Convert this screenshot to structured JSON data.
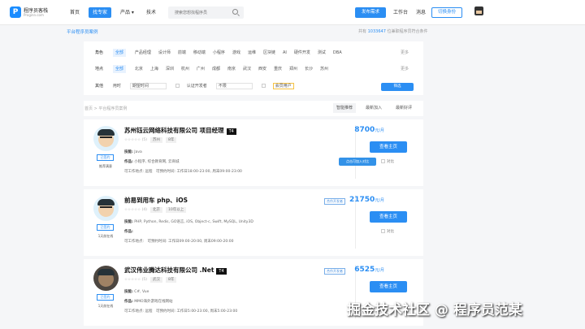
{
  "brand": {
    "title": "程序员客栈",
    "subtitle": "Proginn.com",
    "accent": "#2b8ef3"
  },
  "nav": [
    "首页",
    "找专家",
    "产品",
    "技术"
  ],
  "nav_active": 1,
  "search": {
    "placeholder": "搜索您想找程序员"
  },
  "header": {
    "post_label": "发布需求",
    "workbench": "工作台",
    "messages": "消息",
    "switch_label": "切换身份"
  },
  "subheader": {
    "link": "平台程序员案例",
    "stat_prefix": "共有",
    "stat_count": "1033647",
    "stat_suffix": "位兼职程序员符合条件"
  },
  "filters": {
    "role_label": "角色",
    "roles": [
      "全部",
      "产品经理",
      "设计师",
      "前端",
      "移动端",
      "小程序",
      "游戏",
      "运维",
      "区块链",
      "AI",
      "硬件开发",
      "测试",
      "DBA"
    ],
    "location_label": "地点",
    "locations": [
      "全部",
      "北京",
      "上海",
      "深圳",
      "杭州",
      "广州",
      "成都",
      "南京",
      "武汉",
      "西安",
      "重庆",
      "郑州",
      "长沙",
      "苏州"
    ],
    "more": "更多",
    "other_label": "其他",
    "time_label": "用时",
    "time_placeholder": "期望时间",
    "certified_label": "认证开发者",
    "certified_placeholder": "不限",
    "member_label": "会员用户",
    "filter_button": "筛选"
  },
  "sortbar": {
    "breadcrumb": "首页 > 平台程序员案例",
    "sorts": [
      "智能推荐",
      "最新加入",
      "最新好评"
    ]
  },
  "developers": [
    {
      "name": "苏州钰云网络科技有限公司 项目经理",
      "level": "T4",
      "rating": "(5)",
      "city": "苏州",
      "years": "8年",
      "skills_label": "技能:",
      "skills": "Java",
      "works_label": "作品:",
      "works": "小程序, 综合教育网, 云商城",
      "hours_label": "可工作地点:",
      "hours": "远程",
      "time_label": "可预约时间:",
      "time": "工作日18:00-23:00, 周末09:00-23:00",
      "price": "8700",
      "unit": "元/月",
      "hire_label": "查看主页",
      "compare_label": "对比",
      "verified_label": "已签约",
      "note": "推荐满意",
      "status": "",
      "tooltip": "点击可加入对比",
      "photo": false
    },
    {
      "name": "前易到用车 php、iOS",
      "level": "",
      "rating": "(4)",
      "city": "北京",
      "years": "10年以上",
      "skills_label": "技能:",
      "skills": "PHP, Python, Redis, GO语言, iOS, Object-c, Swift, MySQL, Unity3D",
      "works_label": "作品:",
      "works": "",
      "hours_label": "可工作地点:",
      "hours": "",
      "time_label": "可预约时间:",
      "time": "工作日09:00-20:00, 周末09:00-20:00",
      "price": "21750",
      "unit": "元/月",
      "hire_label": "查看主页",
      "compare_label": "对比",
      "verified_label": "已签约",
      "note": "1天前在线",
      "status": "合作开发者",
      "tooltip": "",
      "photo": false
    },
    {
      "name": "武汉伟业腾达科技有限公司 .Net",
      "level": "T4",
      "rating": "(5)",
      "city": "武汉",
      "years": "8年",
      "skills_label": "技能:",
      "skills": "C#, Vue",
      "works_label": "作品:",
      "works": "MMO海外游戏在线网站",
      "hours_label": "可工作地点:",
      "hours": "远程",
      "time_label": "可预约时间:",
      "time": "工作日5:00-23:00, 周末5:00-23:00",
      "price": "6525",
      "unit": "元/月",
      "hire_label": "查看主页",
      "compare_label": "对比",
      "verified_label": "已签约",
      "note": "1天前在线",
      "status": "合作开发者",
      "tooltip": "",
      "photo": true
    }
  ],
  "watermark": "掘金技术社区 @ 程序员范某"
}
